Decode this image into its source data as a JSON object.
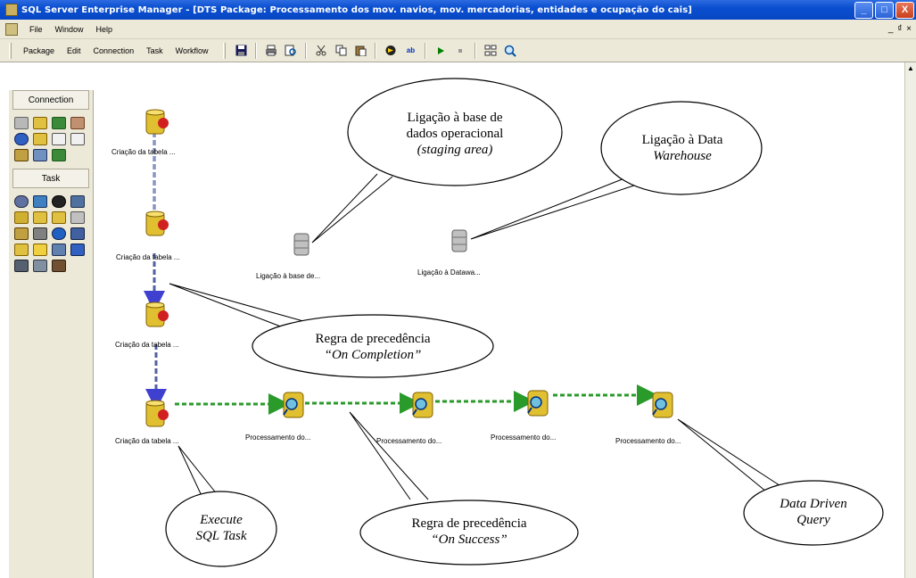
{
  "window": {
    "title": "SQL Server Enterprise Manager - [DTS Package: Processamento dos mov. navios, mov. mercadorias, entidades e ocupação do cais]",
    "controls": [
      "_",
      "□",
      "X"
    ]
  },
  "menubar": {
    "items": [
      "File",
      "Window",
      "Help"
    ],
    "right_controls": "_ ₫ ×"
  },
  "toolbar": {
    "menus": [
      "Package",
      "Edit",
      "Connection",
      "Task",
      "Workflow"
    ],
    "buttons": [
      "save-icon",
      "print-icon",
      "print-preview-icon",
      "cut-icon",
      "copy-icon",
      "paste-icon",
      "connection-icon",
      "rename-icon",
      "run-icon",
      "stop-icon",
      "layout-icon",
      "zoom-icon"
    ]
  },
  "palette": {
    "connection_title": "Connection",
    "task_title": "Task"
  },
  "nodes": {
    "sql1": "Criação da tabela ...",
    "sql2": "Criação da tabela ...",
    "sql3": "Criação da tabela ...",
    "sql4": "Criação da tabela ...",
    "conn1": "Ligação à base de...",
    "conn2": "Ligação à Datawa...",
    "ddq1": "Processamento do...",
    "ddq2": "Processamento do...",
    "ddq3": "Processamento do...",
    "ddq4": "Processamento do..."
  },
  "callouts": {
    "staging_line1": "Ligação à base de",
    "staging_line2": "dados operacional",
    "staging_line3": "(staging area)",
    "dw_line1": "Ligação à Data",
    "dw_line2": "Warehouse",
    "completion_line1": "Regra de precedência",
    "completion_line2": "“On Completion”",
    "success_line1": "Regra de precedência",
    "success_line2": "“On Success”",
    "sqltask_line1": "Execute",
    "sqltask_line2": "SQL Task",
    "ddq_line1": "Data Driven",
    "ddq_line2": "Query"
  }
}
